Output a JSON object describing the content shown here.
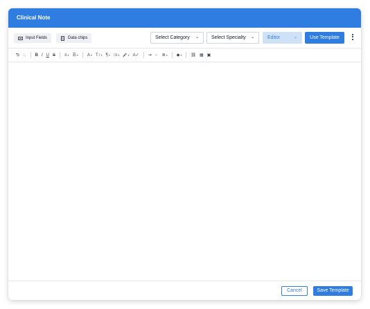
{
  "header": {
    "title": "Clinical Note"
  },
  "toolbar_top": {
    "input_fields_label": "Input Fields",
    "data_chips_label": "Data chips",
    "category_select": "Select Category",
    "specialty_select": "Select Specialty",
    "mode_select": "Editor",
    "use_template_label": "Use Template"
  },
  "format_toolbar": {
    "undo": "⮌",
    "redo": "⮎",
    "bold": "B",
    "italic": "I",
    "underline": "U",
    "strikethrough": "S",
    "align": "≡",
    "line_height": "☰",
    "font_color": "A",
    "font_size": "T↕",
    "paragraph": "¶",
    "list": "⁝≡",
    "microphone": "🎤",
    "spellcheck": "A✓",
    "indent": "⇥",
    "outdent": "⇤",
    "text_align": "≣",
    "fill": "◆",
    "link": "⛓",
    "table": "▦",
    "image": "▣"
  },
  "footer": {
    "cancel_label": "Cancel",
    "save_label": "Save Template"
  },
  "colors": {
    "accent": "#2f7de1",
    "editor_select_bg": "#cfe1f7"
  }
}
